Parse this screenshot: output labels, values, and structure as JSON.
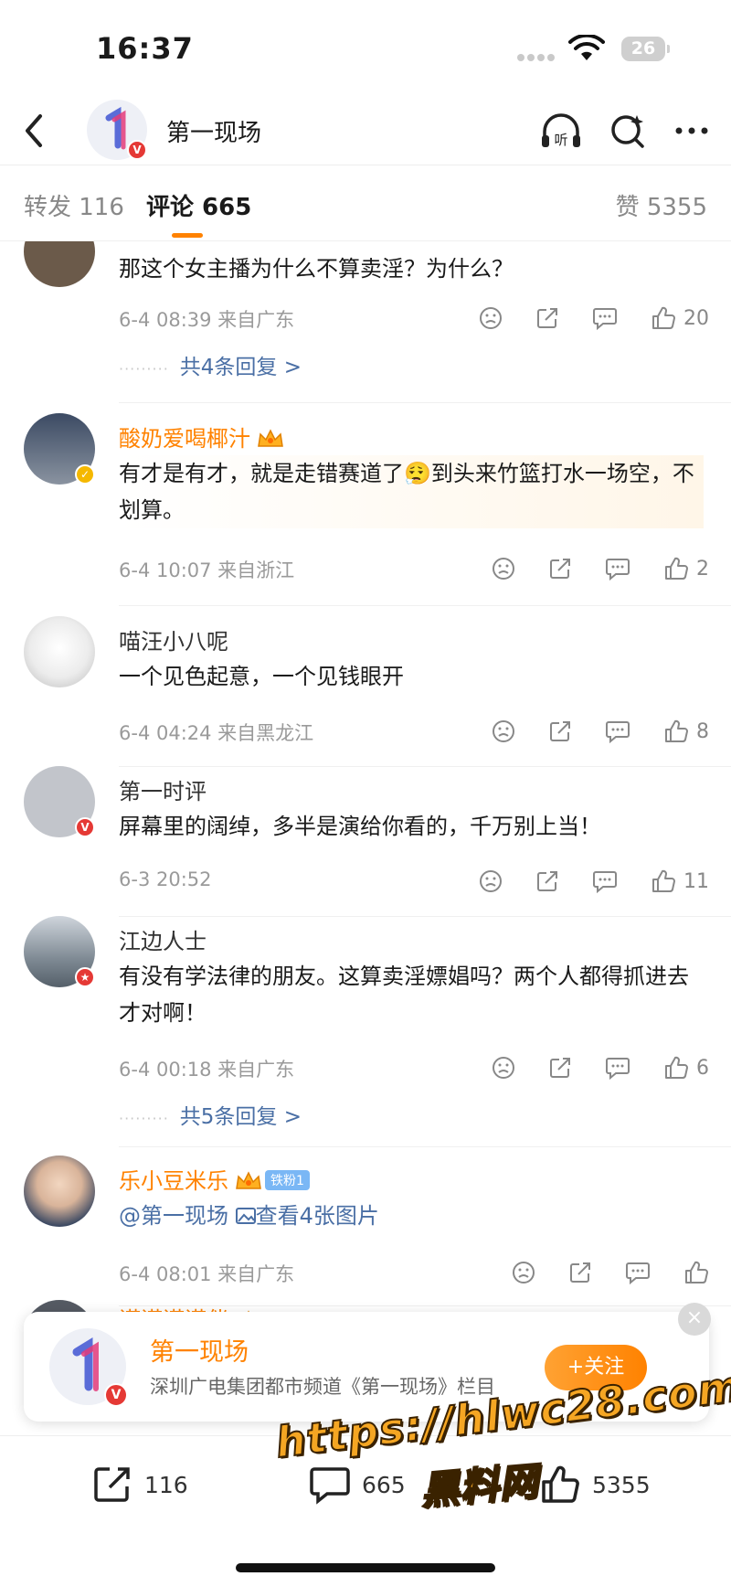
{
  "status_bar": {
    "time": "16:37",
    "battery": "26"
  },
  "header": {
    "title": "第一现场"
  },
  "tabs": [
    {
      "label": "转发 116"
    },
    {
      "label": "评论 665"
    },
    {
      "label": "赞 5355"
    }
  ],
  "comments": [
    {
      "name": "",
      "text": "那这个女主播为什么不算卖淫？为什么？",
      "meta": "6-4 08:39 来自广东",
      "likes": "20",
      "replies": "共4条回复 >"
    },
    {
      "name": "酸奶爱喝椰汁",
      "text": "有才是有才，就是走错赛道了😮‍💨到头来竹篮打水一场空，不划算。",
      "meta": "6-4 10:07 来自浙江",
      "likes": "2"
    },
    {
      "name": "喵汪小八呢",
      "text": "一个见色起意，一个见钱眼开",
      "meta": "6-4 04:24 来自黑龙江",
      "likes": "8"
    },
    {
      "name": "第一时评",
      "text": "屏幕里的阔绰，多半是演给你看的，千万别上当！",
      "meta": "6-3 20:52",
      "likes": "11"
    },
    {
      "name": "江边人士",
      "text": "有没有学法律的朋友。这算卖淫嫖娼吗？两个人都得抓进去才对啊！",
      "meta": "6-4 00:18 来自广东",
      "likes": "6",
      "replies": "共5条回复 >"
    },
    {
      "name": "乐小豆米乐",
      "fan_badge": "铁粉1",
      "mention": "@第一现场",
      "image_link": "查看4张图片",
      "meta": "6-4 08:01 来自广东"
    },
    {
      "name": "谨谨谨谨伴"
    }
  ],
  "follow_banner": {
    "title": "第一现场",
    "subtitle": "深圳广电集团都市频道《第一现场》栏目",
    "button": "+关注",
    "close": "×"
  },
  "bottom_bar": {
    "repost": "116",
    "comment": "665",
    "like": "5355"
  },
  "watermark": {
    "line1": "https://hlwc28.com",
    "line2": "黑料网"
  },
  "colors": {
    "accent": "#ff8200",
    "link": "#4a6fa5",
    "verified": "#e53935"
  }
}
